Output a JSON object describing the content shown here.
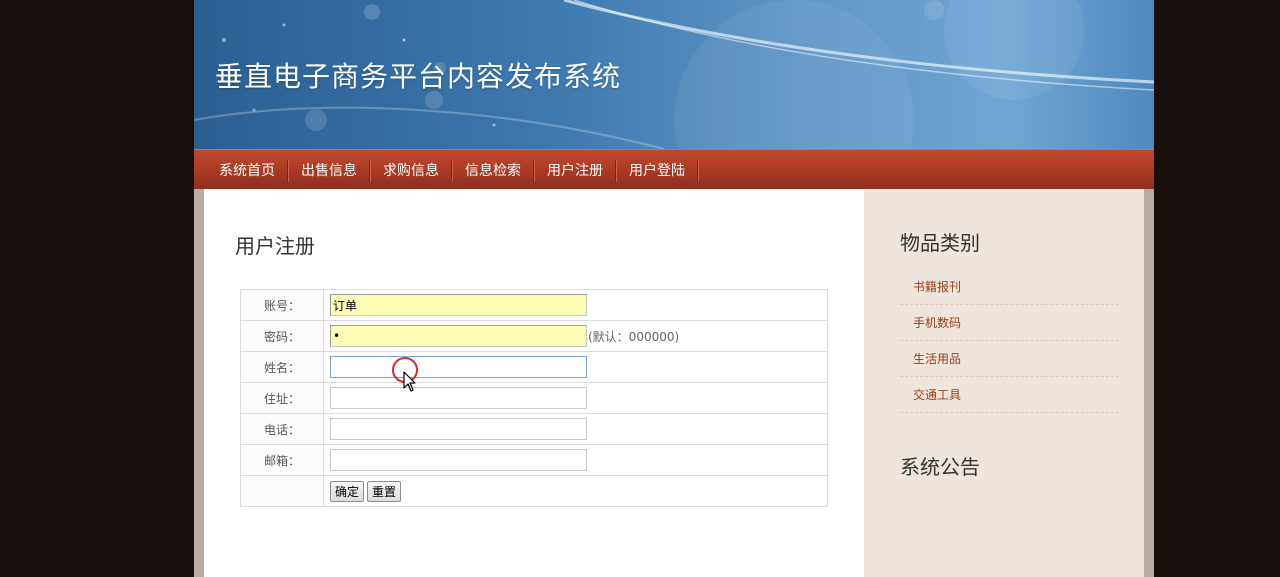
{
  "header": {
    "title": "垂直电子商务平台内容发布系统"
  },
  "nav": [
    {
      "label": "系统首页"
    },
    {
      "label": "出售信息"
    },
    {
      "label": "求购信息"
    },
    {
      "label": "信息检索"
    },
    {
      "label": "用户注册"
    },
    {
      "label": "用户登陆"
    }
  ],
  "main": {
    "title": "用户注册",
    "form": {
      "account": {
        "label": "账号：",
        "value": "订单"
      },
      "password": {
        "label": "密码：",
        "value": "•",
        "hint": "(默认：000000)"
      },
      "name": {
        "label": "姓名：",
        "value": ""
      },
      "address": {
        "label": "住址：",
        "value": ""
      },
      "phone": {
        "label": "电话：",
        "value": ""
      },
      "email": {
        "label": "邮箱：",
        "value": ""
      },
      "submit_label": "确定",
      "reset_label": "重置"
    }
  },
  "sidebar": {
    "categories_title": "物品类别",
    "categories": [
      {
        "label": "书籍报刊"
      },
      {
        "label": "手机数码"
      },
      {
        "label": "生活用品"
      },
      {
        "label": "交通工具"
      }
    ],
    "notice_title": "系统公告"
  },
  "colors": {
    "nav_bg": "#a83a24",
    "category_link": "#9b3e16",
    "filled_input_bg": "#fffcb8",
    "sidebar_bg": "#efe5dc",
    "cursor_ring": "#d22a2a"
  },
  "icons": {
    "cursor": "mouse-pointer-icon"
  }
}
